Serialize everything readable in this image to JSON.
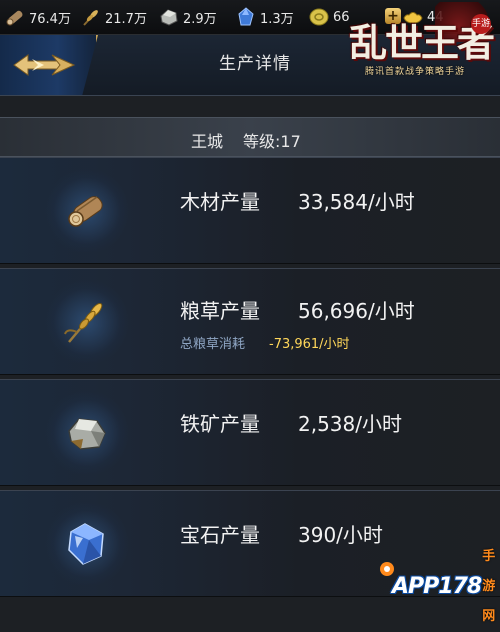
{
  "resources": {
    "wood": {
      "value": "76.4万",
      "icon": "wood-log-icon"
    },
    "grain": {
      "value": "21.7万",
      "icon": "wheat-icon"
    },
    "iron": {
      "value": "2.9万",
      "icon": "iron-ore-icon"
    },
    "gem": {
      "value": "1.3万",
      "icon": "gem-icon"
    },
    "coin": {
      "value": "66",
      "icon": "coin-icon"
    },
    "gold": {
      "value": "44",
      "icon": "gold-ingot-icon"
    }
  },
  "header": {
    "title": "生产详情"
  },
  "logo": {
    "text": "乱世王者",
    "badge": "手游",
    "subtitle": "腾讯首款战争策略手游"
  },
  "city": {
    "name": "王城",
    "level": "等级:17"
  },
  "production": [
    {
      "label": "木材产量",
      "rate": "33,584/小时",
      "icon": "wood-log-icon"
    },
    {
      "label": "粮草产量",
      "rate": "56,696/小时",
      "icon": "wheat-icon",
      "consumption_label": "总粮草消耗",
      "consumption_value": "-73,961/小时"
    },
    {
      "label": "铁矿产量",
      "rate": "2,538/小时",
      "icon": "iron-ore-icon"
    },
    {
      "label": "宝石产量",
      "rate": "390/小时",
      "icon": "gem-icon"
    }
  ],
  "watermark": {
    "text": "APP178",
    "suffix": "手游网"
  },
  "colors": {
    "consumption": "#ffd75a",
    "accent_gold": "#c9a55a",
    "background": "#1d2024"
  }
}
